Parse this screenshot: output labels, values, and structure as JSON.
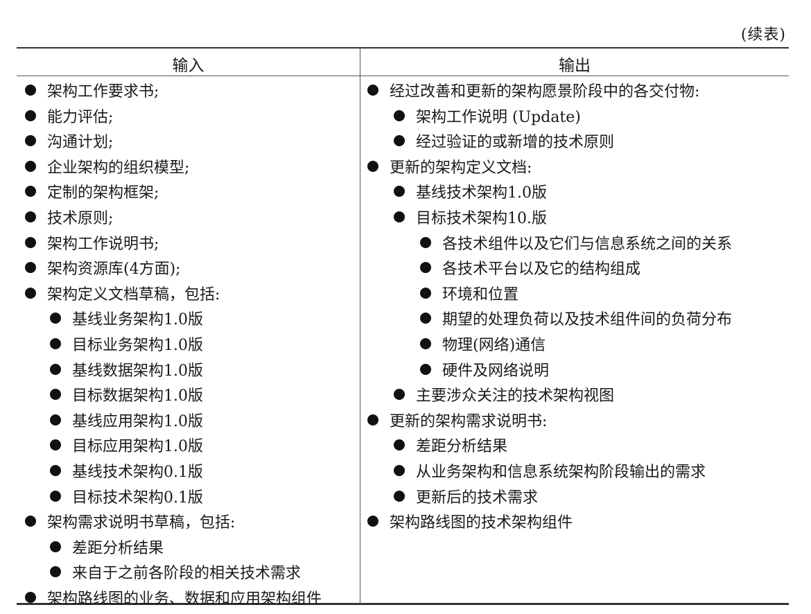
{
  "caption": "(续表)",
  "headers": {
    "input": "输入",
    "output": "输出"
  },
  "input_items": [
    {
      "level": 0,
      "text": "架构工作要求书;"
    },
    {
      "level": 0,
      "text": "能力评估;"
    },
    {
      "level": 0,
      "text": "沟通计划;"
    },
    {
      "level": 0,
      "text": "企业架构的组织模型;"
    },
    {
      "level": 0,
      "text": "定制的架构框架;"
    },
    {
      "level": 0,
      "text": "技术原则;"
    },
    {
      "level": 0,
      "text": "架构工作说明书;"
    },
    {
      "level": 0,
      "text": "架构资源库(4方面);"
    },
    {
      "level": 0,
      "text": "架构定义文档草稿，包括:"
    },
    {
      "level": 1,
      "text": "基线业务架构1.0版"
    },
    {
      "level": 1,
      "text": "目标业务架构1.0版"
    },
    {
      "level": 1,
      "text": "基线数据架构1.0版"
    },
    {
      "level": 1,
      "text": "目标数据架构1.0版"
    },
    {
      "level": 1,
      "text": "基线应用架构1.0版"
    },
    {
      "level": 1,
      "text": "目标应用架构1.0版"
    },
    {
      "level": 1,
      "text": "基线技术架构0.1版"
    },
    {
      "level": 1,
      "text": "目标技术架构0.1版"
    },
    {
      "level": 0,
      "text": "架构需求说明书草稿，包括:"
    },
    {
      "level": 1,
      "text": "差距分析结果"
    },
    {
      "level": 1,
      "text": "来自于之前各阶段的相关技术需求"
    },
    {
      "level": 0,
      "text": "架构路线图的业务、数据和应用架构组件"
    }
  ],
  "output_items": [
    {
      "level": 0,
      "text": "经过改善和更新的架构愿景阶段中的各交付物:"
    },
    {
      "level": 1,
      "text": "架构工作说明 (Update)"
    },
    {
      "level": 1,
      "text": "经过验证的或新增的技术原则"
    },
    {
      "level": 0,
      "text": "更新的架构定义文档:"
    },
    {
      "level": 1,
      "text": "基线技术架构1.0版"
    },
    {
      "level": 1,
      "text": "目标技术架构10.版"
    },
    {
      "level": 2,
      "text": "各技术组件以及它们与信息系统之间的关系"
    },
    {
      "level": 2,
      "text": "各技术平台以及它的结构组成"
    },
    {
      "level": 2,
      "text": "环境和位置"
    },
    {
      "level": 2,
      "text": "期望的处理负荷以及技术组件间的负荷分布"
    },
    {
      "level": 2,
      "text": "物理(网络)通信"
    },
    {
      "level": 2,
      "text": "硬件及网络说明"
    },
    {
      "level": 1,
      "text": "主要涉众关注的技术架构视图"
    },
    {
      "level": 0,
      "text": "更新的架构需求说明书:"
    },
    {
      "level": 1,
      "text": "差距分析结果"
    },
    {
      "level": 1,
      "text": "从业务架构和信息系统架构阶段输出的需求"
    },
    {
      "level": 1,
      "text": "更新后的技术需求"
    },
    {
      "level": 0,
      "text": "架构路线图的技术架构组件"
    }
  ]
}
